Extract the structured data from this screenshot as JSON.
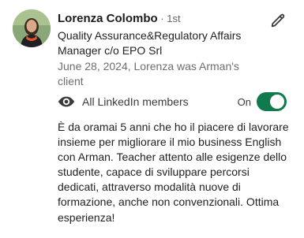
{
  "person": {
    "name": "Lorenza Colombo",
    "degree": " · 1st",
    "headline": "Quality Assurance&Regulatory Affairs Manager c/o EPO Srl",
    "meta": "June 28, 2024, Lorenza was Arman's client"
  },
  "visibility": {
    "label": "All LinkedIn members",
    "icon": "eye-icon",
    "toggle_label": "On",
    "toggle_on": true,
    "toggle_color": "#0f7b4c"
  },
  "edit": {
    "icon": "pencil-icon"
  },
  "recommendation": {
    "text": "È da oramai 5 anni che ho il piacere di lavorare insieme per migliorare il mio business English con Arman. Teacher attento alle esigenze dello studente, capace di sviluppare percorsi dedicati, attraverso modalità nuove di formazione, anche non convenzionali. Ottima esperienza!"
  }
}
